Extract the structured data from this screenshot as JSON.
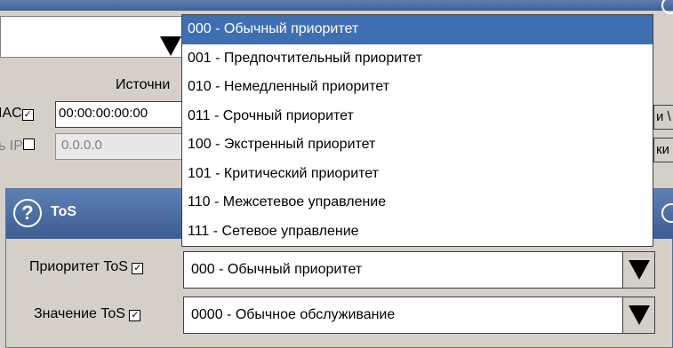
{
  "background_fields": {
    "source_label": "Источни",
    "mac_label": "IAC",
    "mac_value": "00:00:00:00:00",
    "ip_label": "ь IP",
    "ip_value": "0.0.0.0",
    "right_btn1": "и \\",
    "right_btn2": "ки"
  },
  "tos": {
    "title": "ToS",
    "priority_label": "Приоритет ToS",
    "priority_value": "000 - Обычный приоритет",
    "value_label": "Значение ToS",
    "value_value": "0000 - Обычное обслуживание"
  },
  "dropdown": {
    "options": [
      "000 - Обычный приоритет",
      "001 - Предпочтительный приоритет",
      "010 - Немедленный приоритет",
      "011 - Срочный приоритет",
      "100 - Экстренный приоритет",
      "101 - Критический приоритет",
      "110 - Межсетевое управление",
      "111 - Сетевое управление"
    ]
  },
  "check_mark": "✓",
  "help_glyph": "?",
  "colors": {
    "accent": "#3f6fb3",
    "panel": "#d4d0c8"
  }
}
